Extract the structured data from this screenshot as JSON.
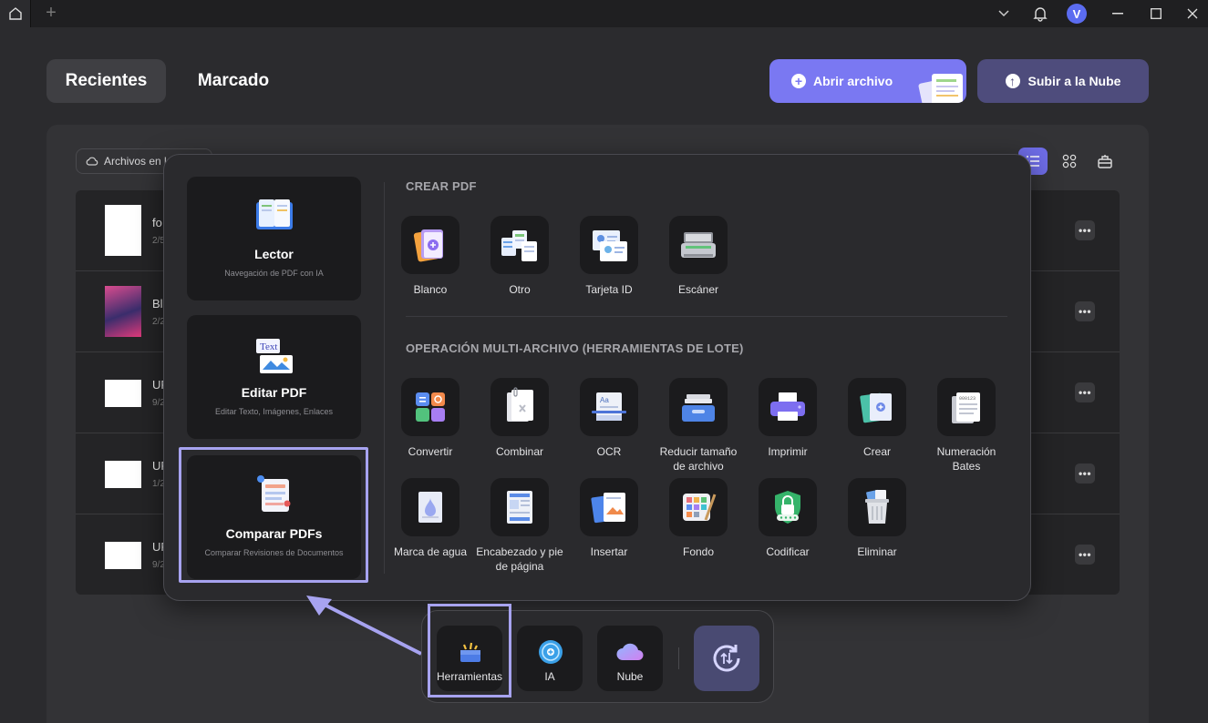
{
  "titlebar": {
    "avatar_letter": "V"
  },
  "tabs": {
    "recent": "Recientes",
    "marked": "Marcado"
  },
  "actions": {
    "open": "Abrir archivo",
    "cloud": "Subir a la Nube"
  },
  "filter": {
    "label": "Archivos en la"
  },
  "files": [
    {
      "title": "fo",
      "sub": "2/5"
    },
    {
      "title": "Blu",
      "sub": "2/2"
    },
    {
      "title": "UP",
      "sub": "9/2"
    },
    {
      "title": "UP",
      "sub": "1/2"
    },
    {
      "title": "UP",
      "sub": "9/2"
    }
  ],
  "more": "•••",
  "modes": [
    {
      "title": "Lector",
      "sub": "Navegación de PDF con IA",
      "icon": "book-icon"
    },
    {
      "title": "Editar PDF",
      "sub": "Editar Texto, Imágenes, Enlaces",
      "icon": "edit-text-icon"
    },
    {
      "title": "Comparar PDFs",
      "sub": "Comparar Revisiones de Documentos",
      "icon": "compare-icon"
    }
  ],
  "create": {
    "heading": "CREAR PDF",
    "tools": [
      {
        "label": "Blanco",
        "icon": "blank-pdf-icon"
      },
      {
        "label": "Otro",
        "icon": "other-files-icon"
      },
      {
        "label": "Tarjeta ID",
        "icon": "id-card-icon"
      },
      {
        "label": "Escáner",
        "icon": "scanner-icon"
      }
    ]
  },
  "batch": {
    "heading": "OPERACIÓN MULTI-ARCHIVO (HERRAMIENTAS DE LOTE)",
    "tools": [
      {
        "label": "Convertir",
        "icon": "convert-icon"
      },
      {
        "label": "Combinar",
        "icon": "combine-icon"
      },
      {
        "label": "OCR",
        "icon": "ocr-icon"
      },
      {
        "label": "Reducir tamaño de archivo",
        "icon": "compress-icon"
      },
      {
        "label": "Imprimir",
        "icon": "print-icon"
      },
      {
        "label": "Crear",
        "icon": "create-icon"
      },
      {
        "label": "Numeración Bates",
        "icon": "bates-icon"
      },
      {
        "label": "Marca de agua",
        "icon": "watermark-icon"
      },
      {
        "label": "Encabezado y pie de página",
        "icon": "header-footer-icon"
      },
      {
        "label": "Insertar",
        "icon": "insert-icon"
      },
      {
        "label": "Fondo",
        "icon": "background-icon"
      },
      {
        "label": "Codificar",
        "icon": "encrypt-icon"
      },
      {
        "label": "Eliminar",
        "icon": "delete-icon"
      }
    ]
  },
  "dock": {
    "tools": "Herramientas",
    "ai": "IA",
    "cloud": "Nube"
  },
  "colors": {
    "accent": "#7a78f2",
    "highlight": "#a7a3f0",
    "panel": "#333336"
  }
}
